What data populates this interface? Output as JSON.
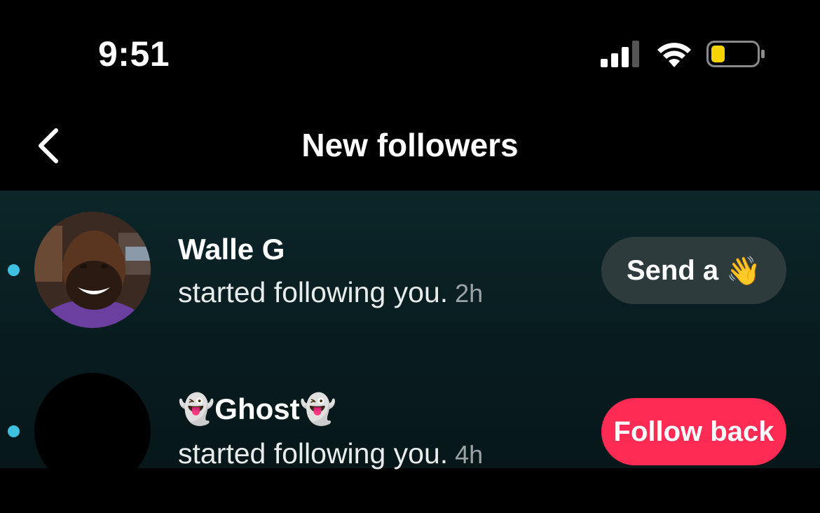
{
  "status_bar": {
    "time": "9:51"
  },
  "header": {
    "title": "New followers",
    "back_icon": "chevron-left-icon"
  },
  "followers": [
    {
      "name": "Walle G",
      "activity": "started following you.",
      "time_ago": "2h",
      "button_label": "Send a",
      "button_emoji": "👋",
      "unread": true
    },
    {
      "name": "👻Ghost👻",
      "activity": "started following you.",
      "time_ago": "4h",
      "button_label": "Follow back",
      "unread": true
    }
  ],
  "colors": {
    "accent": "#fe2c55",
    "unread_dot": "#3ec0e0",
    "list_bg": "#0c2629",
    "wave_button": "#2d3b3d"
  }
}
